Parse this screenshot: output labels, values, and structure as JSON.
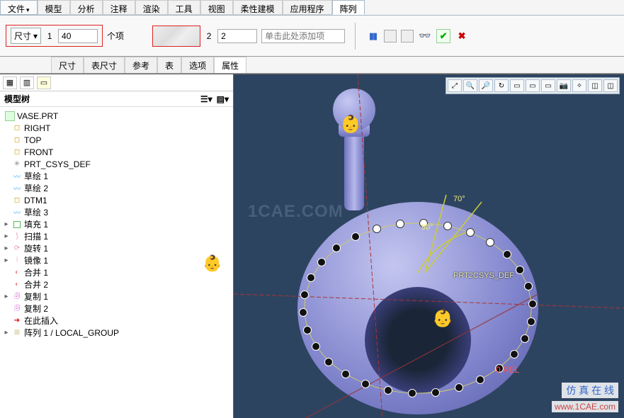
{
  "menu": {
    "file": "文件",
    "items": [
      "模型",
      "分析",
      "注释",
      "渲染",
      "工具",
      "视图",
      "柔性建模",
      "应用程序"
    ],
    "array_tab": "阵列"
  },
  "params": {
    "dim_label": "尺寸",
    "dir1_index": "1",
    "dir1_value": "40",
    "dir1_items": "个项",
    "dir2_index": "2",
    "dir2_value": "2",
    "add_hint": "单击此处添加项"
  },
  "subtabs": [
    "尺寸",
    "表尺寸",
    "参考",
    "表",
    "选项",
    "属性"
  ],
  "tree": {
    "title": "模型树",
    "root": "VASE.PRT",
    "items": [
      {
        "icon": "plane",
        "label": "RIGHT"
      },
      {
        "icon": "plane",
        "label": "TOP"
      },
      {
        "icon": "plane",
        "label": "FRONT"
      },
      {
        "icon": "csys",
        "label": "PRT_CSYS_DEF"
      },
      {
        "icon": "sketch",
        "label": "草绘 1"
      },
      {
        "icon": "sketch",
        "label": "草绘 2"
      },
      {
        "icon": "plane",
        "label": "DTM1"
      },
      {
        "icon": "sketch",
        "label": "草绘 3"
      },
      {
        "icon": "fill",
        "label": "填充 1",
        "exp": true
      },
      {
        "icon": "feat",
        "label": "扫描 1",
        "exp": true
      },
      {
        "icon": "feat",
        "label": "旋转 1",
        "exp": true
      },
      {
        "icon": "feat",
        "label": "镜像 1",
        "exp": true
      },
      {
        "icon": "merge",
        "label": "合并 1"
      },
      {
        "icon": "merge",
        "label": "合并 2"
      },
      {
        "icon": "copy",
        "label": "复制 1",
        "exp": true
      },
      {
        "icon": "copy",
        "label": "复制 2"
      },
      {
        "icon": "here",
        "label": "在此插入"
      },
      {
        "icon": "array",
        "label": "阵列 1 / LOCAL_GROUP",
        "exp": true
      }
    ]
  },
  "viewport": {
    "watermark": "1CAE.COM",
    "tag": "仿 真 在 线",
    "link": "www.1CAE.com",
    "csys": "PRT2CSYS_DEF",
    "angle1": "70°",
    "angle2": "90°",
    "rel": "0 REL"
  }
}
